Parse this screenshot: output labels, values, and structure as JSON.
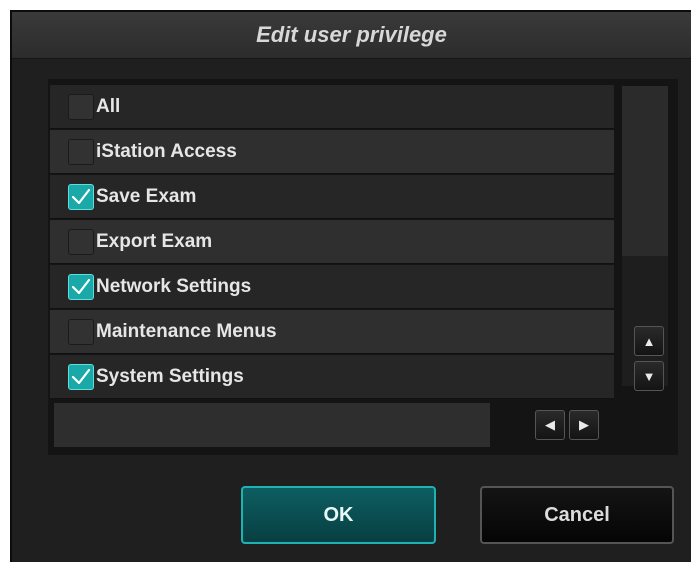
{
  "dialog": {
    "title": "Edit user privilege",
    "ok_label": "OK",
    "cancel_label": "Cancel"
  },
  "privileges": [
    {
      "label": "All",
      "checked": false
    },
    {
      "label": "iStation Access",
      "checked": false
    },
    {
      "label": "Save Exam",
      "checked": true
    },
    {
      "label": "Export Exam",
      "checked": false
    },
    {
      "label": "Network Settings",
      "checked": true
    },
    {
      "label": "Maintenance Menus",
      "checked": false
    },
    {
      "label": "System Settings",
      "checked": true
    }
  ],
  "scrollbar": {
    "up_icon": "triangle-up-icon",
    "down_icon": "triangle-down-icon",
    "left_icon": "triangle-left-icon",
    "right_icon": "triangle-right-icon"
  },
  "colors": {
    "accent": "#1fb2b4",
    "checked_fill": "#1aa8a8",
    "background": "#1f1f1f"
  }
}
